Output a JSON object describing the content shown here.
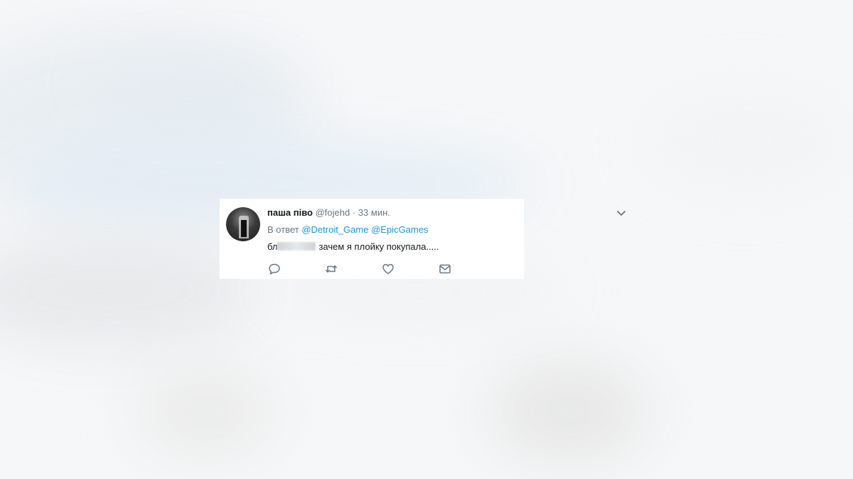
{
  "tweet": {
    "author_name": "паша піво",
    "author_handle": "@fojehd",
    "separator": "·",
    "time": "33 мин.",
    "reply_prefix": "В ответ",
    "reply_mentions": [
      "@Detroit_Game",
      "@EpicGames"
    ],
    "text_redacted_prefix": "бл",
    "text": "зачем я плойку покупала....."
  },
  "icons": {
    "menu": "chevron-down-icon",
    "reply": "reply-icon",
    "retweet": "retweet-icon",
    "like": "heart-icon",
    "dm": "envelope-icon"
  },
  "colors": {
    "link": "#1b95e0",
    "muted": "#657786",
    "text": "#14171a"
  }
}
